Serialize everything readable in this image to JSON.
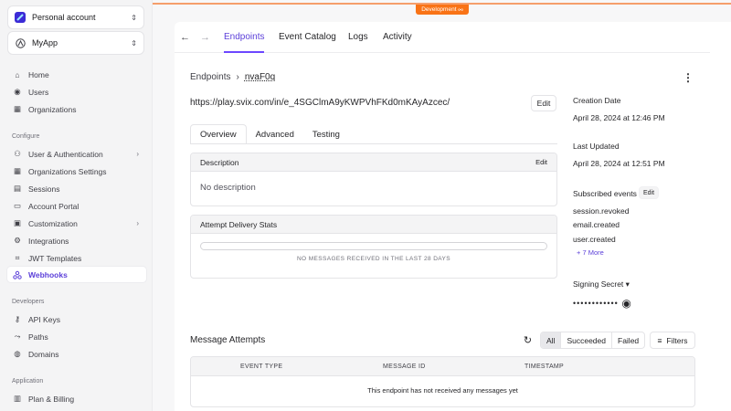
{
  "sidebar": {
    "account": "Personal account",
    "app": "MyApp",
    "items_top": [
      "Home",
      "Users",
      "Organizations"
    ],
    "configure_header": "Configure",
    "items_configure": [
      "User & Authentication",
      "Organizations Settings",
      "Sessions",
      "Account Portal",
      "Customization",
      "Integrations",
      "JWT Templates",
      "Webhooks"
    ],
    "developers_header": "Developers",
    "items_developers": [
      "API Keys",
      "Paths",
      "Domains"
    ],
    "application_header": "Application",
    "items_application": [
      "Plan & Billing"
    ]
  },
  "env_badge": "Development",
  "tabs": [
    "Endpoints",
    "Event Catalog",
    "Logs",
    "Activity"
  ],
  "breadcrumb": {
    "parent": "Endpoints",
    "id": "nvaF0q"
  },
  "endpoint_url": "https://play.svix.com/in/e_4SGClmA9yKWPVhFKd0mKAyAzcec/",
  "edit_label": "Edit",
  "subtabs": [
    "Overview",
    "Advanced",
    "Testing"
  ],
  "description": {
    "header": "Description",
    "edit": "Edit",
    "value": "No description"
  },
  "stats": {
    "header": "Attempt Delivery Stats",
    "empty": "NO MESSAGES RECEIVED IN THE LAST 28 DAYS"
  },
  "details": {
    "created_label": "Creation Date",
    "created_value": "April 28, 2024 at 12:46 PM",
    "updated_label": "Last Updated",
    "updated_value": "April 28, 2024 at 12:51 PM",
    "events_label": "Subscribed events",
    "events_edit": "Edit",
    "events": [
      "session.revoked",
      "email.created",
      "user.created"
    ],
    "more": "+ 7 More",
    "secret_label": "Signing Secret",
    "secret_value": "••••••••••••"
  },
  "attempts": {
    "title": "Message Attempts",
    "filters": [
      "All",
      "Succeeded",
      "Failed"
    ],
    "filters_button": "Filters",
    "columns": [
      "EVENT TYPE",
      "MESSAGE ID",
      "TIMESTAMP"
    ],
    "empty": "This endpoint has not received any messages yet"
  },
  "colors": {
    "accent": "#6c47ff",
    "dev": "#f97316"
  }
}
